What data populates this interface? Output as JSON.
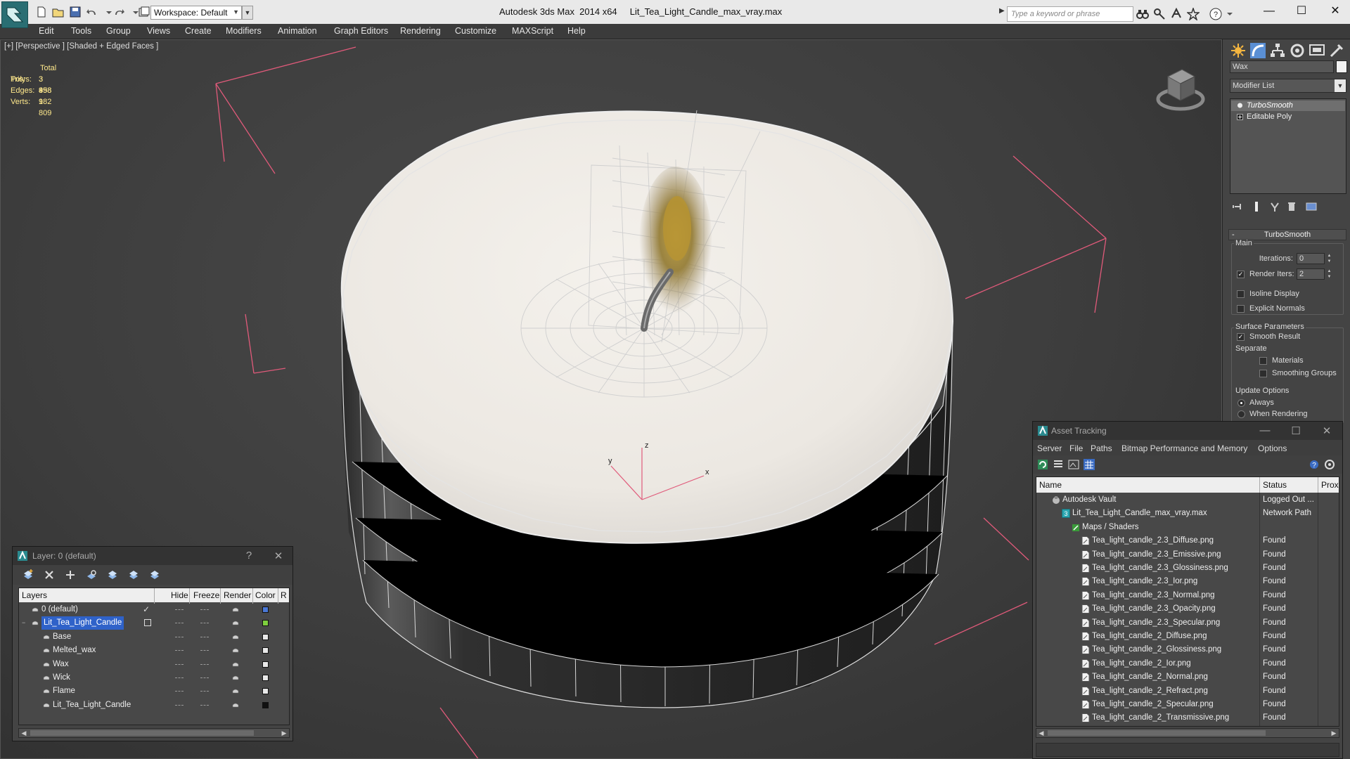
{
  "window": {
    "title": "Autodesk 3ds Max  2014 x64     Lit_Tea_Light_Candle_max_vray.max",
    "workspace_label": "Workspace: Default",
    "search_placeholder": "Type a keyword or phrase",
    "minimize": "—",
    "maximize": "☐",
    "close": "✕"
  },
  "menu": [
    "Edit",
    "Tools",
    "Group",
    "Views",
    "Create",
    "Modifiers",
    "Animation",
    "Graph Editors",
    "Rendering",
    "Customize",
    "MAXScript",
    "Help"
  ],
  "viewport": {
    "label": "[+] [Perspective ] [Shaded + Edged Faces ]",
    "stats_header": "Total",
    "stats": [
      {
        "label": "Polys:",
        "value": "3 358"
      },
      {
        "label": "Tris:",
        "value": "3 498"
      },
      {
        "label": "Edges:",
        "value": "9 982"
      },
      {
        "label": "Verts:",
        "value": "1 809"
      }
    ],
    "axis_labels": {
      "x": "x",
      "y": "y",
      "z": "z"
    }
  },
  "command_panel": {
    "object_name": "Wax",
    "modifier_list": "Modifier List",
    "stack": [
      {
        "label": "TurboSmooth",
        "selected": true
      },
      {
        "label": "Editable Poly",
        "selected": false
      }
    ],
    "rollout_title": "TurboSmooth",
    "main_group": "Main",
    "iterations_label": "Iterations:",
    "iterations_value": "0",
    "render_iters_label": "Render Iters:",
    "render_iters_value": "2",
    "isoline_label": "Isoline Display",
    "explicit_normals_label": "Explicit Normals",
    "surface_group": "Surface Parameters",
    "smooth_result_label": "Smooth Result",
    "separate_label": "Separate",
    "materials_label": "Materials",
    "smoothing_groups_label": "Smoothing Groups",
    "update_group": "Update Options",
    "always_label": "Always",
    "when_rendering_label": "When Rendering"
  },
  "asset_tracking": {
    "title": "Asset Tracking",
    "menu": [
      "Server",
      "File",
      "Paths",
      "Bitmap Performance and Memory",
      "Options"
    ],
    "columns": [
      "Name",
      "Status",
      "Prox"
    ],
    "rows": [
      {
        "name": "Autodesk Vault",
        "status": "Logged Out ...",
        "indent": 0,
        "icon": "vault"
      },
      {
        "name": "Lit_Tea_Light_Candle_max_vray.max",
        "status": "Network Path",
        "indent": 1,
        "icon": "max"
      },
      {
        "name": "Maps / Shaders",
        "status": "",
        "indent": 2,
        "icon": "maps"
      },
      {
        "name": "Tea_light_candle_2.3_Diffuse.png",
        "status": "Found",
        "indent": 3,
        "icon": "file"
      },
      {
        "name": "Tea_light_candle_2.3_Emissive.png",
        "status": "Found",
        "indent": 3,
        "icon": "file"
      },
      {
        "name": "Tea_light_candle_2.3_Glossiness.png",
        "status": "Found",
        "indent": 3,
        "icon": "file"
      },
      {
        "name": "Tea_light_candle_2.3_Ior.png",
        "status": "Found",
        "indent": 3,
        "icon": "file"
      },
      {
        "name": "Tea_light_candle_2.3_Normal.png",
        "status": "Found",
        "indent": 3,
        "icon": "file"
      },
      {
        "name": "Tea_light_candle_2.3_Opacity.png",
        "status": "Found",
        "indent": 3,
        "icon": "file"
      },
      {
        "name": "Tea_light_candle_2.3_Specular.png",
        "status": "Found",
        "indent": 3,
        "icon": "file"
      },
      {
        "name": "Tea_light_candle_2_Diffuse.png",
        "status": "Found",
        "indent": 3,
        "icon": "file"
      },
      {
        "name": "Tea_light_candle_2_Glossiness.png",
        "status": "Found",
        "indent": 3,
        "icon": "file"
      },
      {
        "name": "Tea_light_candle_2_Ior.png",
        "status": "Found",
        "indent": 3,
        "icon": "file"
      },
      {
        "name": "Tea_light_candle_2_Normal.png",
        "status": "Found",
        "indent": 3,
        "icon": "file"
      },
      {
        "name": "Tea_light_candle_2_Refract.png",
        "status": "Found",
        "indent": 3,
        "icon": "file"
      },
      {
        "name": "Tea_light_candle_2_Specular.png",
        "status": "Found",
        "indent": 3,
        "icon": "file"
      },
      {
        "name": "Tea_light_candle_2_Transmissive.png",
        "status": "Found",
        "indent": 3,
        "icon": "file"
      }
    ]
  },
  "layers": {
    "title": "Layer: 0 (default)",
    "help": "?",
    "close": "✕",
    "columns": [
      "Layers",
      "Hide",
      "Freeze",
      "Render",
      "Color",
      "R"
    ],
    "rows": [
      {
        "name": "0 (default)",
        "level": 0,
        "selected": false,
        "active": true,
        "color": "#4a78d6"
      },
      {
        "name": "Lit_Tea_Light_Candle",
        "level": 0,
        "selected": true,
        "active": false,
        "color": "#7ecf3e"
      },
      {
        "name": "Base",
        "level": 1,
        "selected": false,
        "active": false,
        "color": "#e8e8e8"
      },
      {
        "name": "Melted_wax",
        "level": 1,
        "selected": false,
        "active": false,
        "color": "#e8e8e8"
      },
      {
        "name": "Wax",
        "level": 1,
        "selected": false,
        "active": false,
        "color": "#e8e8e8"
      },
      {
        "name": "Wick",
        "level": 1,
        "selected": false,
        "active": false,
        "color": "#e8e8e8"
      },
      {
        "name": "Flame",
        "level": 1,
        "selected": false,
        "active": false,
        "color": "#e8e8e8"
      },
      {
        "name": "Lit_Tea_Light_Candle",
        "level": 1,
        "selected": false,
        "active": false,
        "color": "#111111"
      }
    ]
  },
  "colors": {
    "stats_text": "#ffe98c",
    "selection": "#2f62c9",
    "app_accent": "#2a6e73"
  }
}
